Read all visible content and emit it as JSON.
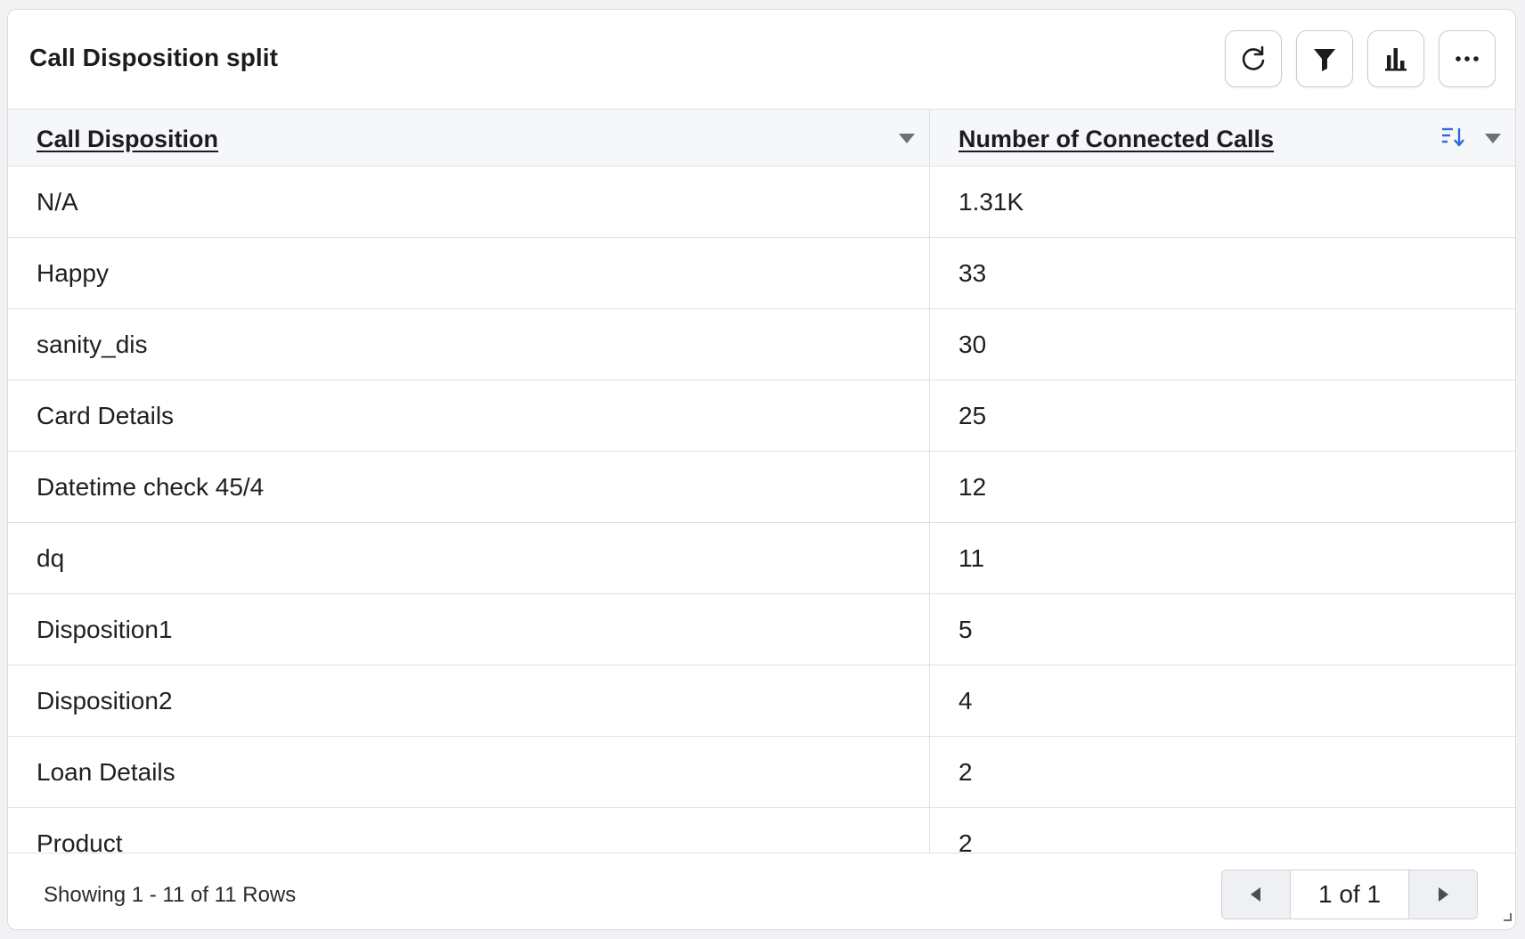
{
  "widget": {
    "title": "Call Disposition split",
    "actions": [
      {
        "icon": "refresh-icon"
      },
      {
        "icon": "filter-icon"
      },
      {
        "icon": "bar-chart-icon"
      },
      {
        "icon": "more-horizontal-icon"
      }
    ]
  },
  "table": {
    "columns": [
      "Call Disposition",
      "Number of Connected Calls"
    ],
    "sort_icon": "sort-descending-icon",
    "rows": [
      [
        "N/A",
        "1.31K"
      ],
      [
        "Happy",
        "33"
      ],
      [
        "sanity_dis",
        "30"
      ],
      [
        "Card Details",
        "25"
      ],
      [
        "Datetime check 45/4",
        "12"
      ],
      [
        "dq",
        "11"
      ],
      [
        "Disposition1",
        "5"
      ],
      [
        "Disposition2",
        "4"
      ],
      [
        "Loan Details",
        "2"
      ],
      [
        "Product",
        "2"
      ]
    ]
  },
  "footer": {
    "status": "Showing 1 - 11 of 11 Rows",
    "page_indicator": "1 of 1"
  },
  "colors": {
    "accent": "#2e6bd8",
    "border": "#dfe1e6",
    "header_bg": "#f6f7f9"
  }
}
